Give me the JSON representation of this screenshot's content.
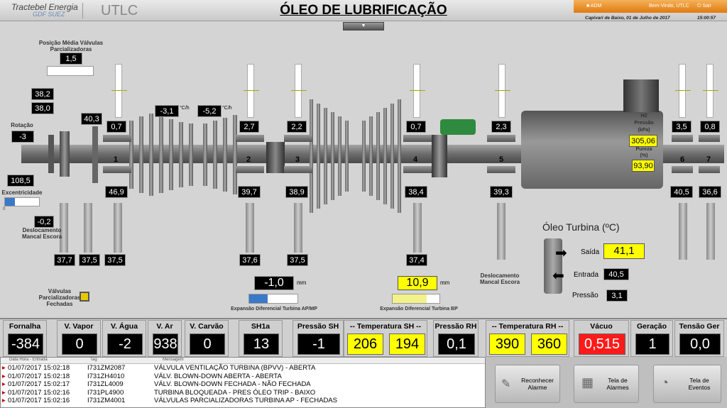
{
  "header": {
    "logo_line1": "Tractebel Energia",
    "logo_line2": "GDF SUEZ",
    "app_name": "UTLC",
    "page_title": "ÓLEO DE LUBRIFICAÇÃO",
    "user_role": "ADM",
    "welcome": "Bem-Vindo, UTLC",
    "logout": "Sair",
    "location_date": "Capivari de Baixo, 01 de Julho de 2017",
    "time": "15:00:57",
    "dropdown_icon": "caret-down-icon"
  },
  "turbine": {
    "valve_avg_label": "Posição Média Válvulas Parcializadoras",
    "valve_avg_value": "1,5",
    "left_values": {
      "v1": "38,2",
      "v2": "38,0",
      "rotation_label": "Rotação",
      "rotation": "-3",
      "eccentric_value": "108,5",
      "eccentric_label": "Excentricidade",
      "eccentric_scale": "0",
      "disp_value": "-0,2",
      "disp_label": "Deslocamento Mancal Escora"
    },
    "rates": [
      {
        "value": "-3,1",
        "unit": "°C/h"
      },
      {
        "value": "-5,2",
        "unit": "°C/h"
      }
    ],
    "bearing_40": "40,3",
    "bearings": [
      {
        "num": "1",
        "top": "0,7",
        "bottom": "46,9"
      },
      {
        "num": "2",
        "top": "2,7",
        "bottom": "39,7"
      },
      {
        "num": "3",
        "top": "2,2",
        "bottom": "38,9"
      },
      {
        "num": "4",
        "top": "0,7",
        "bottom": "38,4"
      },
      {
        "num": "5",
        "top": "2,3",
        "bottom": "39,3"
      },
      {
        "num": "6",
        "top": "3,5",
        "bottom": "40,5"
      },
      {
        "num": "7",
        "top": "0,8",
        "bottom": "36,6"
      }
    ],
    "temps_bottom": [
      "37,7",
      "37,5",
      "37,5",
      "37,6",
      "37,5",
      "37,4"
    ],
    "h2": {
      "title": "H2",
      "pressure_label": "Pressão",
      "pressure_unit": "(kPa)",
      "pressure": "305,06",
      "purity_label": "Pureza",
      "purity_unit": "(%)",
      "purity": "93,90"
    },
    "exp_ap": {
      "value": "-1,0",
      "unit": "mm",
      "label": "Expansão Diferencial Turbina AP/MP"
    },
    "exp_bp": {
      "value": "10,9",
      "unit": "mm",
      "label": "Expansão Diferencial Turbina BP"
    },
    "valves_closed_label": "Válvulas Parcializadoras Fechadas",
    "disp_right_label": "Deslocamento Mancal Escora",
    "oil": {
      "title": "Óleo Turbina (ºC)",
      "out_label": "Saída",
      "out": "41,1",
      "in_label": "Entrada",
      "in": "40,5",
      "press_label": "Pressão",
      "press": "3,1"
    }
  },
  "bottom": [
    {
      "label": "Fornalha",
      "value": "-384",
      "style": "black"
    },
    {
      "label": "V. Vapor",
      "value": "0",
      "style": "black"
    },
    {
      "label": "V. Água",
      "value": "-2",
      "style": "black"
    },
    {
      "label": "V. Ar",
      "value": "938",
      "style": "black"
    },
    {
      "label": "V. Carvão",
      "value": "0",
      "style": "black"
    },
    {
      "label": "SH1a",
      "value": "13",
      "style": "black"
    },
    {
      "label": "Pressão SH",
      "value": "-1",
      "style": "black"
    },
    {
      "label": "-- Temperatura SH --",
      "values": [
        "206",
        "194"
      ]
    },
    {
      "label": "Pressão RH",
      "value": "0,1",
      "style": "black"
    },
    {
      "label": "-- Temperatura RH --",
      "values": [
        "390",
        "360"
      ]
    },
    {
      "label": "Vácuo",
      "value": "0,515",
      "style": "red"
    },
    {
      "label": "Geração",
      "value": "1",
      "style": "black"
    },
    {
      "label": "Tensão Ger",
      "value": "0,0",
      "style": "black"
    }
  ],
  "alarms": {
    "headers": [
      "Data Hora - Entrada",
      "Tag",
      "Mensagem"
    ],
    "rows": [
      {
        "time": "01/07/2017 15:02:18",
        "tag": "I731ZM2087",
        "msg": "VÁLVULA VENTILAÇÃO TURBINA (BPVV) - ABERTA"
      },
      {
        "time": "01/07/2017 15:02:18",
        "tag": "I731ZH4010",
        "msg": "VÁLV. BLOWN-DOWN ABERTA - ABERTA"
      },
      {
        "time": "01/07/2017 15:02:17",
        "tag": "I731ZL4009",
        "msg": "VÁLV. BLOWN-DOWN FECHADA - NÃO FECHADA"
      },
      {
        "time": "01/07/2017 15:02:16",
        "tag": "I731PL4900",
        "msg": "TURBINA BLOQUEADA - PRES ÓLEO TRIP - BAIXO"
      },
      {
        "time": "01/07/2017 15:02:16",
        "tag": "I731ZM4001",
        "msg": "VÁLVULAS PARCIALIZADORAS TURBINA AP - FECHADAS"
      }
    ]
  },
  "buttons": {
    "ack": "Reconhecer Alarme",
    "alarms": "Tela de Alarmes",
    "events": "Tela de Eventos"
  },
  "colors": {
    "yellow": "#ffff00",
    "red": "#ff1a1a",
    "orange": "#e88a1a",
    "accent_blue": "#3b78c8"
  }
}
